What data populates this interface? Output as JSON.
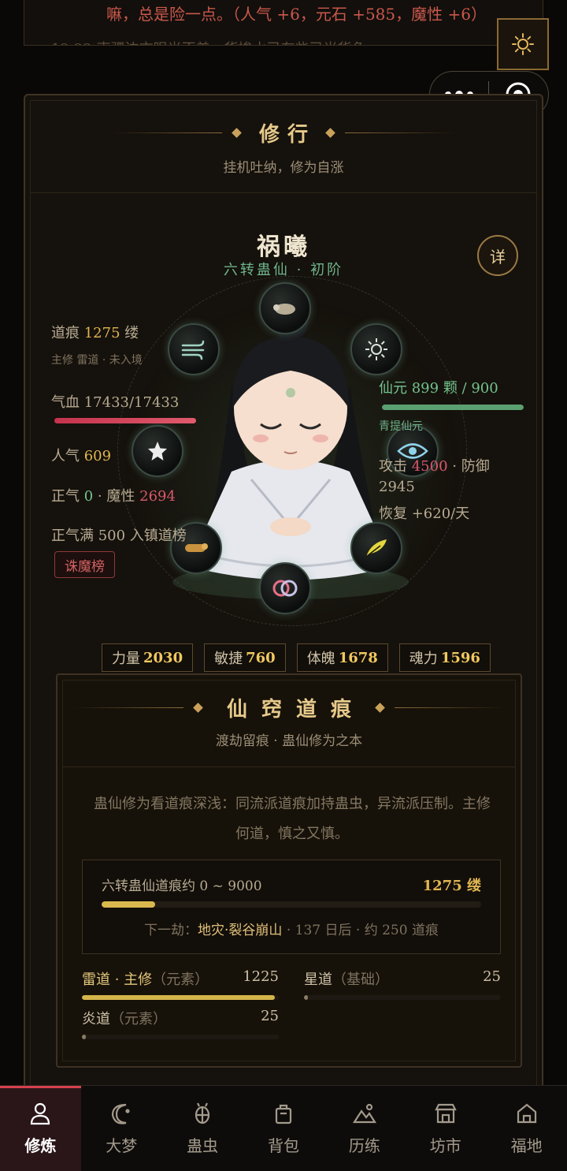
{
  "log": {
    "line1": "嘛，总是险一点。（人气 +6，元石 +585，魔性 +6）",
    "line2": "12:22  南疆边市眼光不差，货掺水已有些已当货色"
  },
  "capsule": {
    "menu_icon": "more-dots-icon",
    "close_icon": "target-icon"
  },
  "cultivation": {
    "title": "修行",
    "subtitle": "挂机吐纳，修为自涨",
    "character": {
      "name": "祸曦",
      "rank": "六转蛊仙 · 初阶",
      "detail_label": "详"
    },
    "left_stats": {
      "daohen_label": "道痕",
      "daohen_value": "1275",
      "daohen_unit": "缕",
      "main_path_note": "主修 雷道 · 未入境",
      "hp_label": "气血",
      "hp_value": "17433/17433",
      "hp_fraction": 1.0,
      "renqi_label": "人气",
      "renqi_value": "609",
      "zhengqi_label": "正气",
      "zhengqi_value": "0",
      "moxing_label": "魔性",
      "moxing_value": "2694",
      "zhengqi_note": "正气满 500 入镇道榜",
      "zhumo_button": "诛魔榜"
    },
    "right_stats": {
      "xianyuan_label": "仙元",
      "xianyuan_value": "899 颗 / 900",
      "xianyuan_fraction": 0.999,
      "xianyuan_type": "青提仙元",
      "attack_label": "攻击",
      "attack_value": "4500",
      "defense_label": "防御",
      "defense_value": "2945",
      "recover_text": "恢复 +620/天"
    },
    "orbs": [
      "cicada-gu-icon",
      "wind-icon",
      "sun-icon",
      "star-icon",
      "eye-icon",
      "worm-gu-icon",
      "feather-icon",
      "rings-icon"
    ],
    "attributes": [
      {
        "label": "力量",
        "value": "2030"
      },
      {
        "label": "敏捷",
        "value": "760"
      },
      {
        "label": "体魄",
        "value": "1678"
      },
      {
        "label": "魂力",
        "value": "1596"
      }
    ]
  },
  "daohen": {
    "title": "仙窍道痕",
    "subtitle": "渡劫留痕 · 蛊仙修为之本",
    "description": "蛊仙修为看道痕深浅：同流派道痕加持蛊虫，异流派压制。主修何道，慎之又慎。",
    "range_label": "六转蛊仙道痕约 0 ~ 9000",
    "range_value": "1275 缕",
    "range_fraction": 0.1417,
    "next_prefix": "下一劫：",
    "next_disaster": "地灾·裂谷崩山",
    "next_suffix": " · 137 日后 · 约 250 道痕",
    "paths": [
      {
        "name": "雷道 · 主修",
        "tag": "（元素）",
        "value": "1225",
        "fraction": 0.98,
        "color": "#d4b54b"
      },
      {
        "name": "星道",
        "tag": "（基础）",
        "value": "25",
        "fraction": 0.02,
        "color": "#8a7d66"
      },
      {
        "name": "炎道",
        "tag": "（元素）",
        "value": "25",
        "fraction": 0.02,
        "color": "#8a7d66"
      }
    ]
  },
  "nav": [
    {
      "label": "修炼",
      "icon": "person-icon",
      "active": true
    },
    {
      "label": "大梦",
      "icon": "moon-icon",
      "active": false
    },
    {
      "label": "蛊虫",
      "icon": "bug-icon",
      "active": false
    },
    {
      "label": "背包",
      "icon": "bag-icon",
      "active": false
    },
    {
      "label": "历练",
      "icon": "mountain-icon",
      "active": false
    },
    {
      "label": "坊市",
      "icon": "shop-icon",
      "active": false
    },
    {
      "label": "福地",
      "icon": "home-icon",
      "active": false
    }
  ]
}
